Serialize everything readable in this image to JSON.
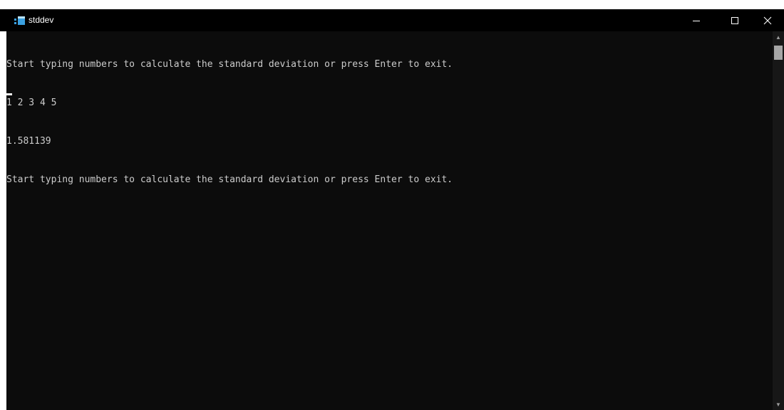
{
  "window": {
    "title": "stddev",
    "icon": "console-app-icon",
    "controls": {
      "minimize": "–",
      "maximize": "☐",
      "close": "✕"
    }
  },
  "console": {
    "lines": [
      "Start typing numbers to calculate the standard deviation or press Enter to exit.",
      "1 2 3 4 5",
      "1.581139",
      "Start typing numbers to calculate the standard deviation or press Enter to exit."
    ]
  },
  "colors": {
    "background": "#0c0c0c",
    "text": "#cccccc",
    "titlebar": "#000000"
  }
}
